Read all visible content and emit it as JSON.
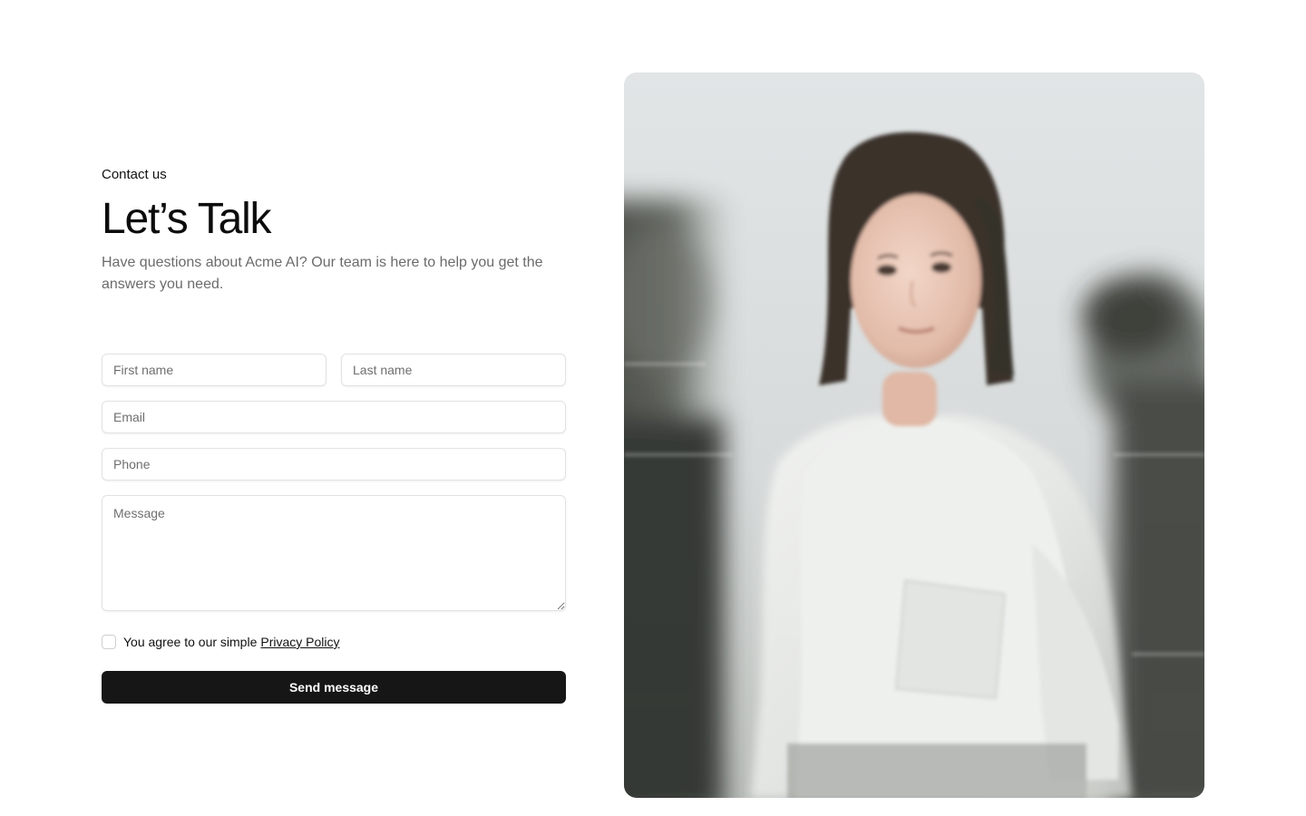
{
  "contact": {
    "eyebrow": "Contact us",
    "title": "Let’s Talk",
    "subtitle": "Have questions about Acme AI? Our team is here to help you get the answers you need."
  },
  "form": {
    "first_name_placeholder": "First name",
    "last_name_placeholder": "Last name",
    "email_placeholder": "Email",
    "phone_placeholder": "Phone",
    "message_placeholder": "Message",
    "consent_text": "You agree to our simple",
    "privacy_link": "Privacy Policy",
    "submit_label": "Send message"
  },
  "colors": {
    "button_bg": "#161616",
    "button_text": "#ffffff",
    "subtitle_text": "#6b6b6b",
    "field_border": "#e2e2e2"
  },
  "image": {
    "description_icon": "photo-woman-white-shirt"
  }
}
